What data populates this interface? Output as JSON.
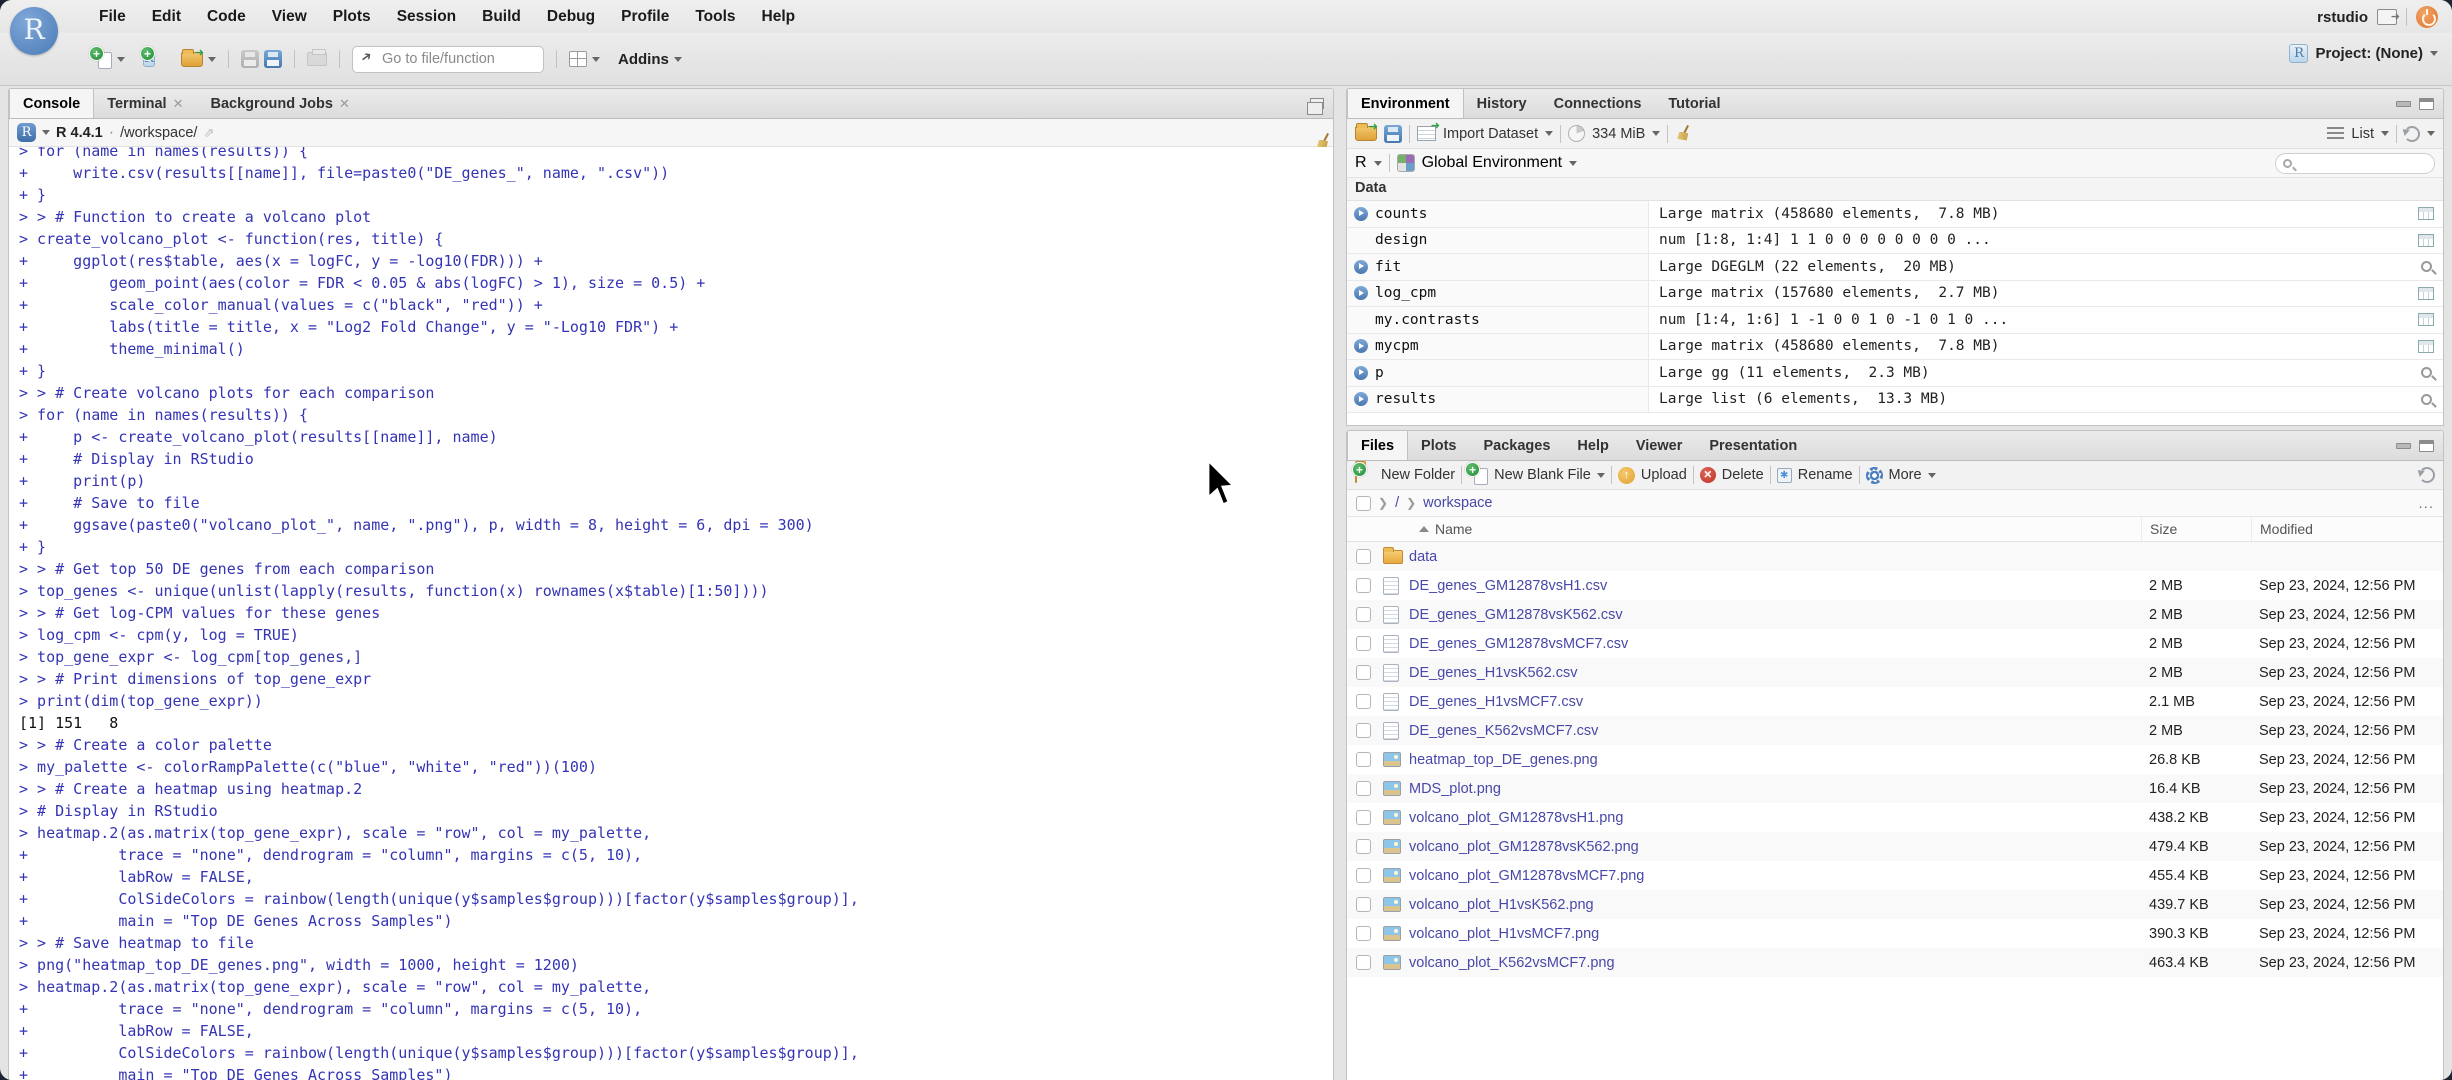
{
  "chrome": {
    "menu_items": [
      "File",
      "Edit",
      "Code",
      "View",
      "Plots",
      "Session",
      "Build",
      "Debug",
      "Profile",
      "Tools",
      "Help"
    ],
    "goto_placeholder": "Go to file/function",
    "addins_label": "Addins",
    "rstudio_label": "rstudio",
    "project_label": "Project: (None)",
    "r_logo_letter": "R"
  },
  "console": {
    "tabs": [
      "Console",
      "Terminal",
      "Background Jobs"
    ],
    "r_version": "R 4.4.1",
    "separator": "·",
    "cwd": "/workspace/",
    "lines": [
      {
        "cls": "in",
        "text": "> for (name in names(results)) {"
      },
      {
        "cls": "in",
        "text": "+     write.csv(results[[name]], file=paste0(\"DE_genes_\", name, \".csv\"))"
      },
      {
        "cls": "in",
        "text": "+ }"
      },
      {
        "cls": "in",
        "text": "> > # Function to create a volcano plot"
      },
      {
        "cls": "in",
        "text": "> create_volcano_plot <- function(res, title) {"
      },
      {
        "cls": "in",
        "text": "+     ggplot(res$table, aes(x = logFC, y = -log10(FDR))) +"
      },
      {
        "cls": "in",
        "text": "+         geom_point(aes(color = FDR < 0.05 & abs(logFC) > 1), size = 0.5) +"
      },
      {
        "cls": "in",
        "text": "+         scale_color_manual(values = c(\"black\", \"red\")) +"
      },
      {
        "cls": "in",
        "text": "+         labs(title = title, x = \"Log2 Fold Change\", y = \"-Log10 FDR\") +"
      },
      {
        "cls": "in",
        "text": "+         theme_minimal()"
      },
      {
        "cls": "in",
        "text": "+ }"
      },
      {
        "cls": "in",
        "text": "> > # Create volcano plots for each comparison"
      },
      {
        "cls": "in",
        "text": "> for (name in names(results)) {"
      },
      {
        "cls": "in",
        "text": "+     p <- create_volcano_plot(results[[name]], name)"
      },
      {
        "cls": "in",
        "text": "+     # Display in RStudio"
      },
      {
        "cls": "in",
        "text": "+     print(p)"
      },
      {
        "cls": "in",
        "text": "+     # Save to file"
      },
      {
        "cls": "in",
        "text": "+     ggsave(paste0(\"volcano_plot_\", name, \".png\"), p, width = 8, height = 6, dpi = 300)"
      },
      {
        "cls": "in",
        "text": "+ }"
      },
      {
        "cls": "in",
        "text": "> > # Get top 50 DE genes from each comparison"
      },
      {
        "cls": "in",
        "text": "> top_genes <- unique(unlist(lapply(results, function(x) rownames(x$table)[1:50])))"
      },
      {
        "cls": "in",
        "text": "> > # Get log-CPM values for these genes"
      },
      {
        "cls": "in",
        "text": "> log_cpm <- cpm(y, log = TRUE)"
      },
      {
        "cls": "in",
        "text": "> top_gene_expr <- log_cpm[top_genes,]"
      },
      {
        "cls": "in",
        "text": "> > # Print dimensions of top_gene_expr"
      },
      {
        "cls": "in",
        "text": "> print(dim(top_gene_expr))"
      },
      {
        "cls": "out",
        "text": "[1] 151   8"
      },
      {
        "cls": "in",
        "text": "> > # Create a color palette"
      },
      {
        "cls": "in",
        "text": "> my_palette <- colorRampPalette(c(\"blue\", \"white\", \"red\"))(100)"
      },
      {
        "cls": "in",
        "text": "> > # Create a heatmap using heatmap.2"
      },
      {
        "cls": "in",
        "text": "> # Display in RStudio"
      },
      {
        "cls": "in",
        "text": "> heatmap.2(as.matrix(top_gene_expr), scale = \"row\", col = my_palette,"
      },
      {
        "cls": "in",
        "text": "+          trace = \"none\", dendrogram = \"column\", margins = c(5, 10),"
      },
      {
        "cls": "in",
        "text": "+          labRow = FALSE,"
      },
      {
        "cls": "in",
        "text": "+          ColSideColors = rainbow(length(unique(y$samples$group)))[factor(y$samples$group)],"
      },
      {
        "cls": "in",
        "text": "+          main = \"Top DE Genes Across Samples\")"
      },
      {
        "cls": "in",
        "text": "> > # Save heatmap to file"
      },
      {
        "cls": "in",
        "text": "> png(\"heatmap_top_DE_genes.png\", width = 1000, height = 1200)"
      },
      {
        "cls": "in",
        "text": "> heatmap.2(as.matrix(top_gene_expr), scale = \"row\", col = my_palette,"
      },
      {
        "cls": "in",
        "text": "+          trace = \"none\", dendrogram = \"column\", margins = c(5, 10),"
      },
      {
        "cls": "in",
        "text": "+          labRow = FALSE,"
      },
      {
        "cls": "in",
        "text": "+          ColSideColors = rainbow(length(unique(y$samples$group)))[factor(y$samples$group)],"
      },
      {
        "cls": "in",
        "text": "+          main = \"Top DE Genes Across Samples\")"
      }
    ]
  },
  "environment": {
    "tabs": [
      "Environment",
      "History",
      "Connections",
      "Tutorial"
    ],
    "import_label": "Import Dataset",
    "memory_label": "334 MiB",
    "lang_label": "R",
    "scope_label": "Global Environment",
    "list_label": "List",
    "section_label": "Data",
    "rows": [
      {
        "name": "counts",
        "value": "Large matrix (458680 elements,  7.8 MB)",
        "arrow": "arr",
        "action": "grid"
      },
      {
        "name": "design",
        "value": "num [1:8, 1:4] 1 1 0 0 0 0 0 0 0 0 ...",
        "arrow": "noarr",
        "action": "grid"
      },
      {
        "name": "fit",
        "value": "Large DGEGLM (22 elements,  20 MB)",
        "arrow": "arr",
        "action": "mag"
      },
      {
        "name": "log_cpm",
        "value": "Large matrix (157680 elements,  2.7 MB)",
        "arrow": "arr",
        "action": "grid"
      },
      {
        "name": "my.contrasts",
        "value": "num [1:4, 1:6] 1 -1 0 0 1 0 -1 0 1 0 ...",
        "arrow": "noarr",
        "action": "grid"
      },
      {
        "name": "mycpm",
        "value": "Large matrix (458680 elements,  7.8 MB)",
        "arrow": "arr",
        "action": "grid"
      },
      {
        "name": "p",
        "value": "Large gg (11 elements,  2.3 MB)",
        "arrow": "arr",
        "action": "mag"
      },
      {
        "name": "results",
        "value": "Large list (6 elements,  13.3 MB)",
        "arrow": "arr",
        "action": "mag"
      }
    ]
  },
  "files": {
    "tabs": [
      "Files",
      "Plots",
      "Packages",
      "Help",
      "Viewer",
      "Presentation"
    ],
    "toolbar": {
      "new_folder": "New Folder",
      "new_blank_file": "New Blank File",
      "upload": "Upload",
      "delete": "Delete",
      "rename": "Rename",
      "more": "More"
    },
    "breadcrumb": {
      "root": "/",
      "folder": "workspace",
      "ellipsis": "..."
    },
    "columns": {
      "name": "Name",
      "size": "Size",
      "modified": "Modified"
    },
    "rows": [
      {
        "type": "folder",
        "name": "data",
        "size": "",
        "modified": ""
      },
      {
        "type": "csv",
        "name": "DE_genes_GM12878vsH1.csv",
        "size": "2 MB",
        "modified": "Sep 23, 2024, 12:56 PM"
      },
      {
        "type": "csv",
        "name": "DE_genes_GM12878vsK562.csv",
        "size": "2 MB",
        "modified": "Sep 23, 2024, 12:56 PM"
      },
      {
        "type": "csv",
        "name": "DE_genes_GM12878vsMCF7.csv",
        "size": "2 MB",
        "modified": "Sep 23, 2024, 12:56 PM"
      },
      {
        "type": "csv",
        "name": "DE_genes_H1vsK562.csv",
        "size": "2 MB",
        "modified": "Sep 23, 2024, 12:56 PM"
      },
      {
        "type": "csv",
        "name": "DE_genes_H1vsMCF7.csv",
        "size": "2.1 MB",
        "modified": "Sep 23, 2024, 12:56 PM"
      },
      {
        "type": "csv",
        "name": "DE_genes_K562vsMCF7.csv",
        "size": "2 MB",
        "modified": "Sep 23, 2024, 12:56 PM"
      },
      {
        "type": "png",
        "name": "heatmap_top_DE_genes.png",
        "size": "26.8 KB",
        "modified": "Sep 23, 2024, 12:56 PM"
      },
      {
        "type": "png",
        "name": "MDS_plot.png",
        "size": "16.4 KB",
        "modified": "Sep 23, 2024, 12:56 PM"
      },
      {
        "type": "png",
        "name": "volcano_plot_GM12878vsH1.png",
        "size": "438.2 KB",
        "modified": "Sep 23, 2024, 12:56 PM"
      },
      {
        "type": "png",
        "name": "volcano_plot_GM12878vsK562.png",
        "size": "479.4 KB",
        "modified": "Sep 23, 2024, 12:56 PM"
      },
      {
        "type": "png",
        "name": "volcano_plot_GM12878vsMCF7.png",
        "size": "455.4 KB",
        "modified": "Sep 23, 2024, 12:56 PM"
      },
      {
        "type": "png",
        "name": "volcano_plot_H1vsK562.png",
        "size": "439.7 KB",
        "modified": "Sep 23, 2024, 12:56 PM"
      },
      {
        "type": "png",
        "name": "volcano_plot_H1vsMCF7.png",
        "size": "390.3 KB",
        "modified": "Sep 23, 2024, 12:56 PM"
      },
      {
        "type": "png",
        "name": "volcano_plot_K562vsMCF7.png",
        "size": "463.4 KB",
        "modified": "Sep 23, 2024, 12:56 PM"
      }
    ]
  }
}
